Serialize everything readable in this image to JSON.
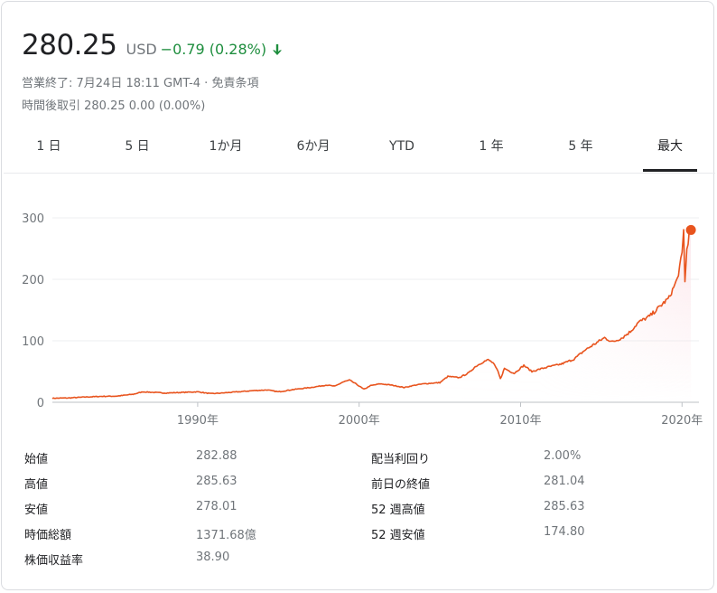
{
  "quote": {
    "price": "280.25",
    "currency": "USD",
    "change": "−0.79 (0.28%)",
    "change_color": "#1e8e3e",
    "direction_icon": "arrow-down-icon",
    "close_info": "営業終了: 7月24日 18:11 GMT-4 · 免責条項",
    "after_hours": "時間後取引 280.25 0.00 (0.00%)"
  },
  "tabs": [
    {
      "label": "1 日"
    },
    {
      "label": "5 日"
    },
    {
      "label": "1か月"
    },
    {
      "label": "6か月"
    },
    {
      "label": "YTD"
    },
    {
      "label": "1 年"
    },
    {
      "label": "5 年"
    },
    {
      "label": "最大",
      "active": true
    }
  ],
  "chart_data": {
    "type": "area",
    "line_color": "#e8541e",
    "fill_color": "#fbe3e8",
    "y_ticks": [
      "0",
      "100",
      "200",
      "300"
    ],
    "x_ticks": [
      "1990年",
      "2000年",
      "2010年",
      "2020年"
    ],
    "ylim": [
      0,
      300
    ],
    "xlim": [
      1981.0,
      2020.6
    ],
    "series": [
      {
        "values": [
          [
            1981.0,
            6.5
          ],
          [
            1982.0,
            7
          ],
          [
            1983.0,
            8.5
          ],
          [
            1984.0,
            9.5
          ],
          [
            1985.0,
            10
          ],
          [
            1986.0,
            13
          ],
          [
            1986.6,
            17
          ],
          [
            1987.3,
            16
          ],
          [
            1988.0,
            15
          ],
          [
            1989.0,
            16
          ],
          [
            1990.0,
            17
          ],
          [
            1990.8,
            14
          ],
          [
            1991.5,
            15
          ],
          [
            1992.5,
            17
          ],
          [
            1993.5,
            19
          ],
          [
            1994.3,
            20
          ],
          [
            1995.0,
            17
          ],
          [
            1996.0,
            21
          ],
          [
            1997.0,
            24
          ],
          [
            1998.0,
            28
          ],
          [
            1998.5,
            26
          ],
          [
            1999.0,
            33
          ],
          [
            1999.4,
            36
          ],
          [
            1999.8,
            30
          ],
          [
            2000.3,
            21
          ],
          [
            2000.7,
            27
          ],
          [
            2001.3,
            30
          ],
          [
            2002.0,
            28
          ],
          [
            2002.8,
            24
          ],
          [
            2003.5,
            28
          ],
          [
            2004.0,
            30
          ],
          [
            2005.0,
            32
          ],
          [
            2005.5,
            42
          ],
          [
            2006.2,
            40
          ],
          [
            2006.8,
            48
          ],
          [
            2007.2,
            58
          ],
          [
            2007.7,
            66
          ],
          [
            2008.0,
            69
          ],
          [
            2008.3,
            64
          ],
          [
            2008.6,
            50
          ],
          [
            2008.75,
            38
          ],
          [
            2009.0,
            55
          ],
          [
            2009.6,
            47
          ],
          [
            2010.2,
            60
          ],
          [
            2010.7,
            50
          ],
          [
            2011.2,
            54
          ],
          [
            2011.8,
            58
          ],
          [
            2012.5,
            62
          ],
          [
            2013.3,
            70
          ],
          [
            2014.0,
            85
          ],
          [
            2014.6,
            95
          ],
          [
            2015.2,
            105
          ],
          [
            2015.7,
            98
          ],
          [
            2016.3,
            105
          ],
          [
            2016.8,
            115
          ],
          [
            2017.3,
            130
          ],
          [
            2018.0,
            140
          ],
          [
            2018.6,
            155
          ],
          [
            2019.2,
            170
          ],
          [
            2019.7,
            200
          ],
          [
            2020.0,
            240
          ],
          [
            2020.1,
            280
          ],
          [
            2020.18,
            195
          ],
          [
            2020.3,
            250
          ],
          [
            2020.45,
            275
          ],
          [
            2020.55,
            280.25
          ]
        ]
      }
    ]
  },
  "stats": {
    "left": [
      {
        "label": "始値",
        "value": "282.88"
      },
      {
        "label": "高値",
        "value": "285.63"
      },
      {
        "label": "安値",
        "value": "278.01"
      },
      {
        "label": "時価総額",
        "value": "1371.68億"
      },
      {
        "label": "株価収益率",
        "value": "38.90"
      }
    ],
    "right": [
      {
        "label": "配当利回り",
        "value": "2.00%"
      },
      {
        "label": "前日の終値",
        "value": "281.04"
      },
      {
        "label": "52 週高値",
        "value": "285.63"
      },
      {
        "label": "52 週安値",
        "value": "174.80"
      }
    ]
  }
}
